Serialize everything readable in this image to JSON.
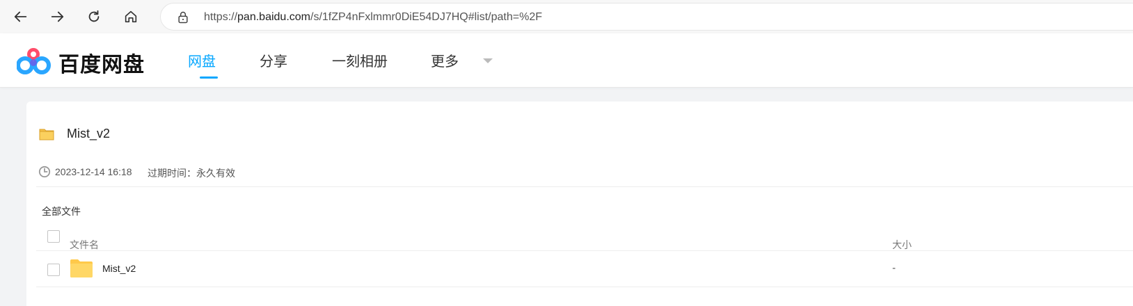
{
  "browser": {
    "url_prefix": "https://",
    "url_domain": "pan.baidu.com",
    "url_path": "/s/1fZP4nFxlmmr0DiE54DJ7HQ#list/path=%2F"
  },
  "header": {
    "logo_text": "百度网盘",
    "tabs": [
      {
        "label": "网盘",
        "active": true
      },
      {
        "label": "分享",
        "active": false
      },
      {
        "label": "一刻相册",
        "active": false
      },
      {
        "label": "更多",
        "active": false
      }
    ],
    "accent_color": "#06a7ff"
  },
  "share": {
    "title": "Mist_v2",
    "date": "2023-12-14 16:18",
    "expiry_label": "过期时间：永久有效"
  },
  "list": {
    "breadcrumb": "全部文件",
    "columns": {
      "name": "文件名",
      "size": "大小"
    },
    "rows": [
      {
        "name": "Mist_v2",
        "size": "-",
        "type": "folder-icon"
      }
    ]
  }
}
